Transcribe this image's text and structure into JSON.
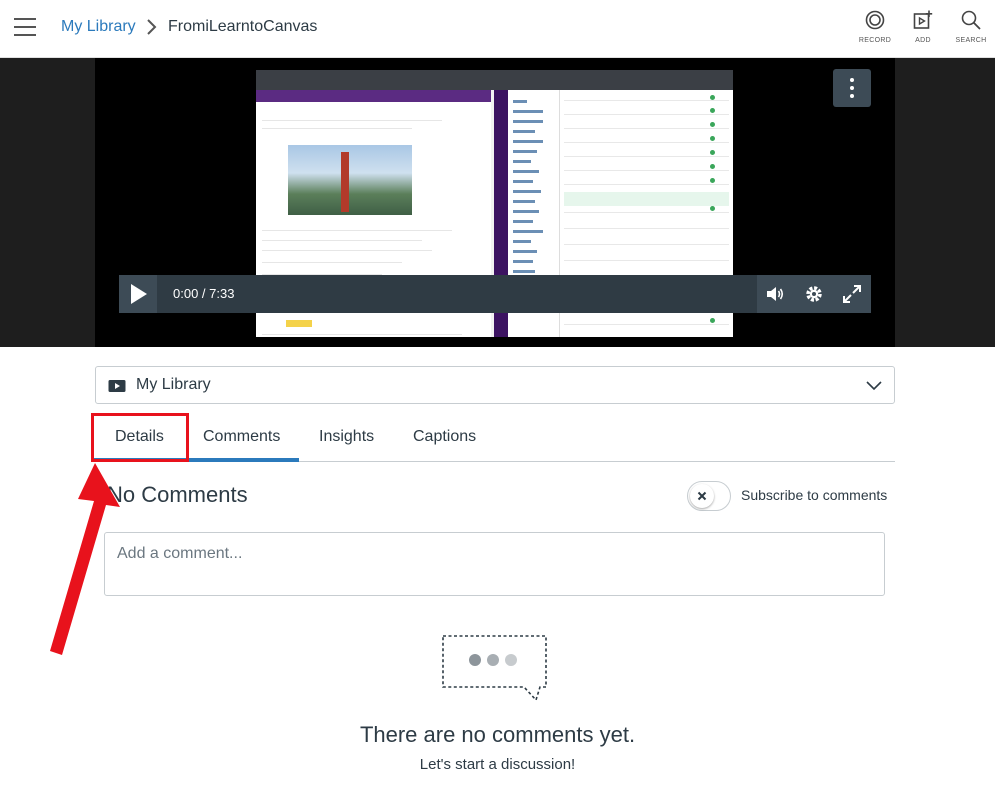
{
  "breadcrumb": {
    "root": "My Library",
    "current": "FromiLearntoCanvas"
  },
  "toolbar": {
    "record_label": "RECORD",
    "add_label": "ADD",
    "search_label": "SEARCH"
  },
  "player": {
    "time": "0:00 / 7:33",
    "progress_fraction": 0.0
  },
  "library_select": {
    "value": "My Library"
  },
  "tabs": [
    {
      "label": "Details"
    },
    {
      "label": "Comments",
      "active": true
    },
    {
      "label": "Insights"
    },
    {
      "label": "Captions"
    }
  ],
  "comments": {
    "heading": "No Comments",
    "subscribe_label": "Subscribe to comments",
    "placeholder": "Add a comment...",
    "empty_title": "There are no comments yet.",
    "empty_subtitle": "Let's start a discussion!"
  },
  "colors": {
    "accent": "#2b7abc",
    "annotation": "#e8121c",
    "player_bar": "#3d4b56"
  }
}
